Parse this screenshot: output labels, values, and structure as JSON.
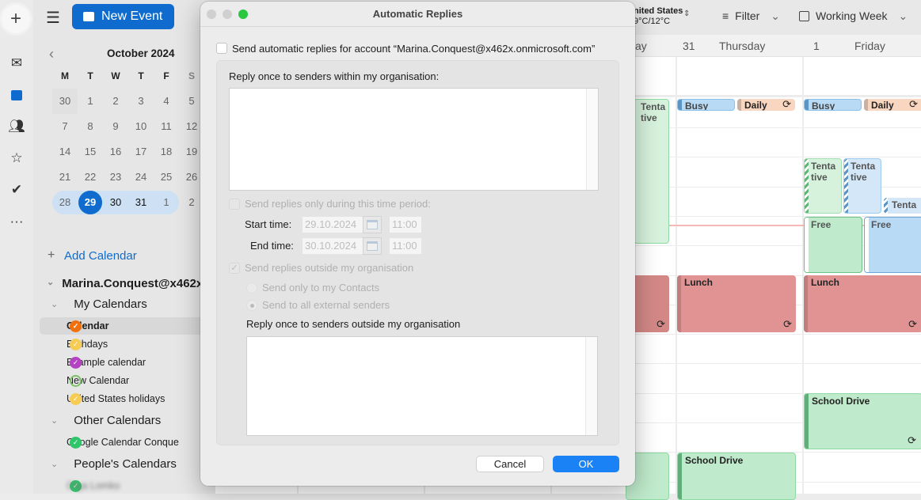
{
  "rail": {
    "icons": [
      "plus-icon",
      "mail-icon",
      "calendar-icon",
      "people-icon",
      "star-icon",
      "tasks-icon",
      "more-icon"
    ]
  },
  "sidebar": {
    "new_event": "New Event",
    "month": "October 2024",
    "weekdays": [
      "M",
      "T",
      "W",
      "T",
      "F",
      "S"
    ],
    "weeks": [
      [
        "30",
        "1",
        "2",
        "3",
        "4",
        "5"
      ],
      [
        "7",
        "8",
        "9",
        "10",
        "11",
        "12"
      ],
      [
        "14",
        "15",
        "16",
        "17",
        "18",
        "19"
      ],
      [
        "21",
        "22",
        "23",
        "24",
        "25",
        "26"
      ],
      [
        "28",
        "29",
        "30",
        "31",
        "1",
        "2"
      ]
    ],
    "today": "29",
    "add_calendar": "Add Calendar",
    "account": "Marina.Conquest@x462x",
    "groups": [
      {
        "label": "My Calendars",
        "items": [
          {
            "label": "Calendar",
            "color": "#f0700f"
          },
          {
            "label": "Birthdays",
            "color": "#f7cc55"
          },
          {
            "label": "Example calendar",
            "color": "#b443c2"
          },
          {
            "label": "New Calendar",
            "color": "#7cc16a",
            "unchecked": true
          },
          {
            "label": "United States holidays",
            "color": "#f7cc55"
          }
        ]
      },
      {
        "label": "Other Calendars",
        "items": [
          {
            "label": "Google Calendar Conque",
            "color": "#2fc56a"
          }
        ]
      },
      {
        "label": "People's Calendars",
        "items": [
          {
            "label": "Olga Lomko",
            "color": "#2fc56a",
            "blurred": true
          }
        ]
      }
    ]
  },
  "toolbar": {
    "weather_location": "nited States",
    "weather_temp": "9°C/12°C",
    "filter": "Filter",
    "view": "Working Week"
  },
  "days": [
    {
      "partial": "ay"
    },
    {
      "num": "31",
      "name": "Thursday"
    },
    {
      "num": "1",
      "name": "Friday"
    }
  ],
  "events": {
    "tentative": "Tenta\ntive",
    "busy": "Busy",
    "daily": "Daily",
    "tenta": "Tenta",
    "free": "Free",
    "lunch": "Lunch",
    "school": "School Drive"
  },
  "colors": {
    "accent": "#0f6cce",
    "busy": "#b9daf5",
    "daily": "#f8d6bf",
    "lunch": "#e09392",
    "green": "#bfeacb"
  },
  "dialog": {
    "title": "Automatic Replies",
    "send_auto": "Send automatic replies for account “Marina.Conquest@x462x.onmicrosoft.com”",
    "within_label": "Reply once to senders within my organisation:",
    "time_period": "Send replies only during this time period:",
    "start_label": "Start time:",
    "start_date": "29.10.2024",
    "start_time": "11:00",
    "end_label": "End time:",
    "end_date": "30.10.2024",
    "end_time": "11:00",
    "outside": "Send replies outside my organisation",
    "contacts_only": "Send only to my Contacts",
    "all_external": "Send to all external senders",
    "outside_label": "Reply once to senders outside my organisation",
    "cancel": "Cancel",
    "ok": "OK"
  }
}
